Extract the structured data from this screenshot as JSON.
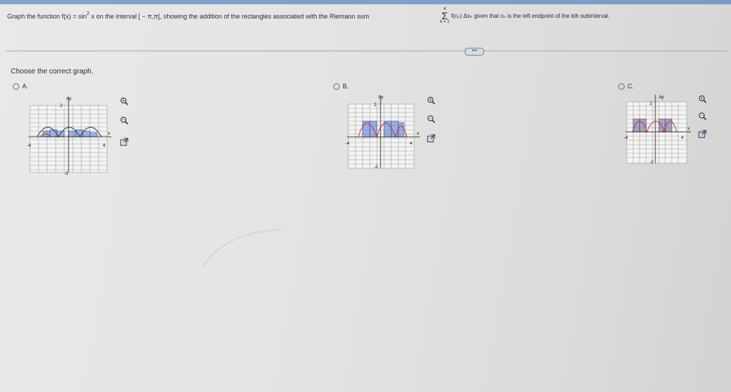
{
  "question": {
    "prefix": "Graph the function f(x) = sin",
    "exponent": "2",
    "middle": " x on the interval [ − π,π], showing the addition of the rectangles associated with the Riemann sum",
    "sum_upper": "4",
    "sum_symbol": "Σ",
    "sum_lower": "k = 1",
    "tail": "f(cₖ) Δxₖ given that cₖ is the left endpoint of the kth subinterval."
  },
  "toolbar": {
    "expand_label": "•••"
  },
  "prompt": "Choose the correct graph.",
  "options": [
    {
      "label": "A.",
      "axis_y": "Ay",
      "axis_x": "x",
      "tick_top": "2",
      "tick_bottom": "-2",
      "tick_left": "-4",
      "tick_right": "4"
    },
    {
      "label": "B.",
      "axis_y": "Ay",
      "axis_x": "x",
      "tick_top": "2",
      "tick_bottom": "-2",
      "tick_left": "-4",
      "tick_right": "4"
    },
    {
      "label": "C.",
      "axis_y": "Ay",
      "axis_x": "x",
      "tick_top": "2",
      "tick_bottom": "-2",
      "tick_left": "-4",
      "tick_right": "4"
    }
  ],
  "icons": [
    "zoom-in-icon",
    "zoom-out-icon",
    "popout-icon"
  ],
  "colors": {
    "curve": "#c0303a",
    "rectangles": "#4a6fbf",
    "accent": "#2a6db0"
  }
}
